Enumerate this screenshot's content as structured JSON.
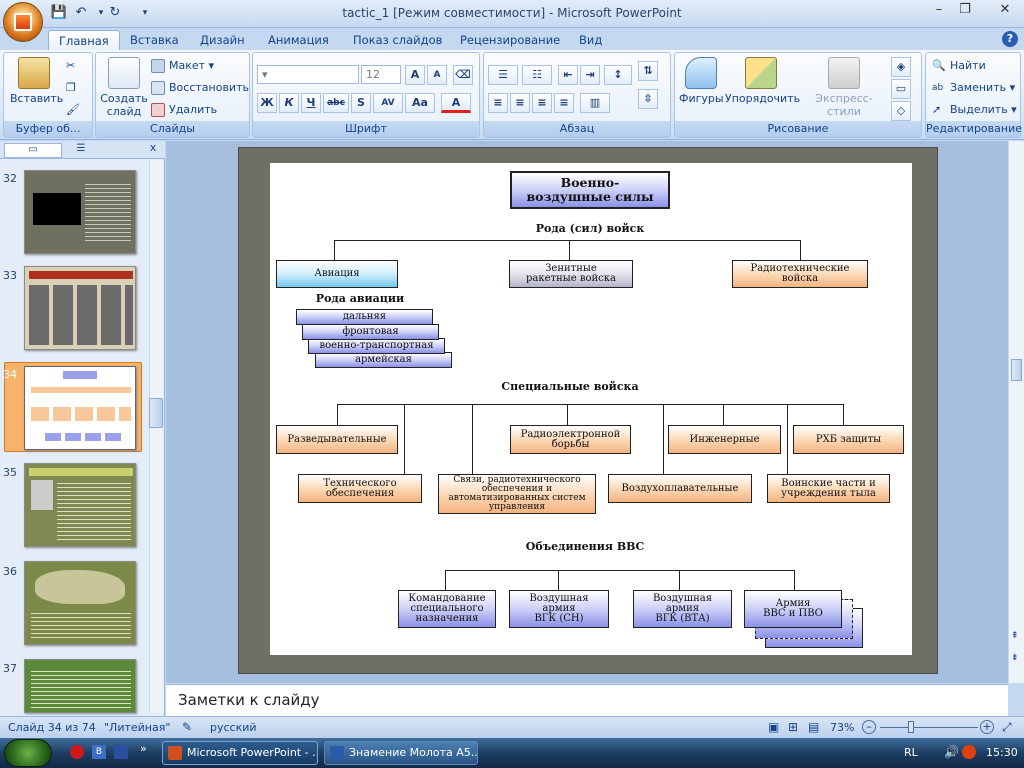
{
  "window": {
    "title": "tactic_1 [Режим совместимости] - Microsoft PowerPoint",
    "minimize": "–",
    "restore": "❐",
    "close": "✕"
  },
  "quick_access": {
    "save": "💾",
    "undo": "↶",
    "redo": "↻",
    "customize": "▾"
  },
  "tabs": [
    "Главная",
    "Вставка",
    "Дизайн",
    "Анимация",
    "Показ слайдов",
    "Рецензирование",
    "Вид"
  ],
  "help": "?",
  "ribbon": {
    "clipboard": {
      "label": "Буфер об...",
      "paste": "Вставить"
    },
    "slides": {
      "label": "Слайды",
      "new_slide": "Создать слайд",
      "layout": "Макет",
      "reset": "Восстановить",
      "delete": "Удалить"
    },
    "font": {
      "label": "Шрифт",
      "size": "12",
      "bold": "Ж",
      "italic": "К",
      "underline": "Ч",
      "strike": "abc",
      "shadow": "S",
      "spacing": "AV",
      "case": "Aa",
      "color": "A",
      "grow": "A",
      "shrink": "A"
    },
    "paragraph": {
      "label": "Абзац"
    },
    "drawing": {
      "label": "Рисование",
      "shapes": "Фигуры",
      "arrange": "Упорядочить",
      "styles": "Экспресс-стили"
    },
    "editing": {
      "label": "Редактирование",
      "find": "Найти",
      "replace": "Заменить",
      "select": "Выделить"
    }
  },
  "thumbnails": [
    {
      "num": "32",
      "bg": "#707060"
    },
    {
      "num": "33",
      "bg": "#d9d0b8"
    },
    {
      "num": "34",
      "bg": "#ffffff"
    },
    {
      "num": "35",
      "bg": "#7f8a52"
    },
    {
      "num": "36",
      "bg": "#7b8a48"
    },
    {
      "num": "37",
      "bg": "#5d8a3a"
    }
  ],
  "slide": {
    "title": "Военно-\nвоздушные силы",
    "branches_header": "Рода (сил) войск",
    "branches": [
      "Авиация",
      "Зенитные\nракетные войска",
      "Радиотехнические\nвойска"
    ],
    "aviation_header": "Рода авиации",
    "aviation": [
      "дальняя",
      "фронтовая",
      "военно-транспортная",
      "армейская"
    ],
    "special_header": "Специальные войска",
    "special_row1": [
      "Разведывательные",
      "Радиоэлектронной\nборьбы",
      "Инженерные",
      "РХБ защиты"
    ],
    "special_row2": [
      "Технического\nобеспечения",
      "Связи, радиотехнического\nобеспечения и\nавтоматизированных систем\nуправления",
      "Воздухоплавательные",
      "Воинские части и\nучреждения тыла"
    ],
    "assoc_header": "Объединения ВВС",
    "assoc": [
      "Командование\nспециального\nназначения",
      "Воздушная\nармия\nВГК (СН)",
      "Воздушная\nармия\nВГК (ВТА)",
      "Армия\nВВС и ПВО"
    ]
  },
  "notes": "Заметки к слайду",
  "status": {
    "slide": "Слайд 34 из 74",
    "theme": "\"Литейная\"",
    "lang": "русский",
    "zoom": "73%"
  },
  "taskbar": {
    "task1": "Microsoft PowerPoint - ...",
    "task2": "Знамение Молота А5...",
    "lang": "RL",
    "time": "15:30"
  }
}
